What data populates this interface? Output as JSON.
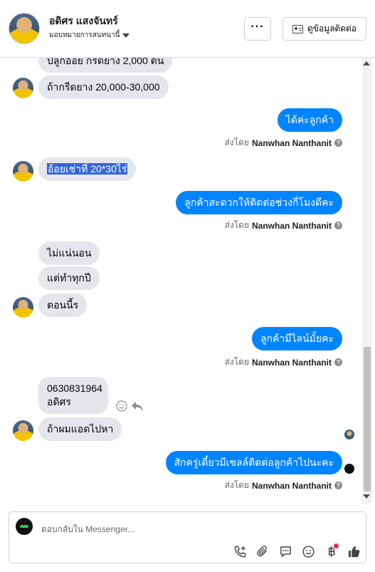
{
  "header": {
    "name": "อดิศร แสงจันทร์",
    "assign_label": "มอบหมายการสนทนานี้",
    "more_label": "···",
    "contact_label": "ดูข้อมูลติดต่อ"
  },
  "messages": [
    {
      "side": "in",
      "text": "ปลูกอ้อย  กรีดยาง 2,000 ต้น"
    },
    {
      "side": "in",
      "text": "ถ้ากรีดยาง 20,000-30,000"
    },
    {
      "side": "out",
      "text": "ได้ค่ะลูกค้า"
    },
    {
      "side": "in",
      "text": "อ้อยเช่าที่ 20*30ไร่",
      "selected": true
    },
    {
      "side": "out",
      "text": "ลูกค้าสะดวกให้ติดต่อช่วงกี่โมงดีคะ"
    },
    {
      "side": "in",
      "text": "ไม่แน่นอน"
    },
    {
      "side": "in",
      "text": "แต่ทำทุกปี"
    },
    {
      "side": "in",
      "text": "ตอนนี้ร"
    },
    {
      "side": "out",
      "text": "ลูกค้ามีไลน์มั้ยคะ"
    },
    {
      "side": "in",
      "text_line1": "0630831964",
      "text_line2": "อดิศร"
    },
    {
      "side": "in",
      "text": "ถ้าผมแอดไปหา"
    },
    {
      "side": "out",
      "text": "สักครู่เดี๋ยวมีเซลล์ติดต่อลูกค้าไปนะคะ"
    }
  ],
  "sent_by": {
    "prefix": "ส่งโดย",
    "name": "Nanwhan Nanthanit",
    "help": "?"
  },
  "composer": {
    "placeholder": "ตอบกลับใน Messenger...",
    "tools": [
      "phone-add-icon",
      "paperclip-icon",
      "saved-reply-icon",
      "emoji-icon",
      "payment-icon",
      "like-icon"
    ]
  },
  "colors": {
    "accent": "#0084ff",
    "incoming": "#e4e6eb",
    "selection": "#3367d6"
  }
}
